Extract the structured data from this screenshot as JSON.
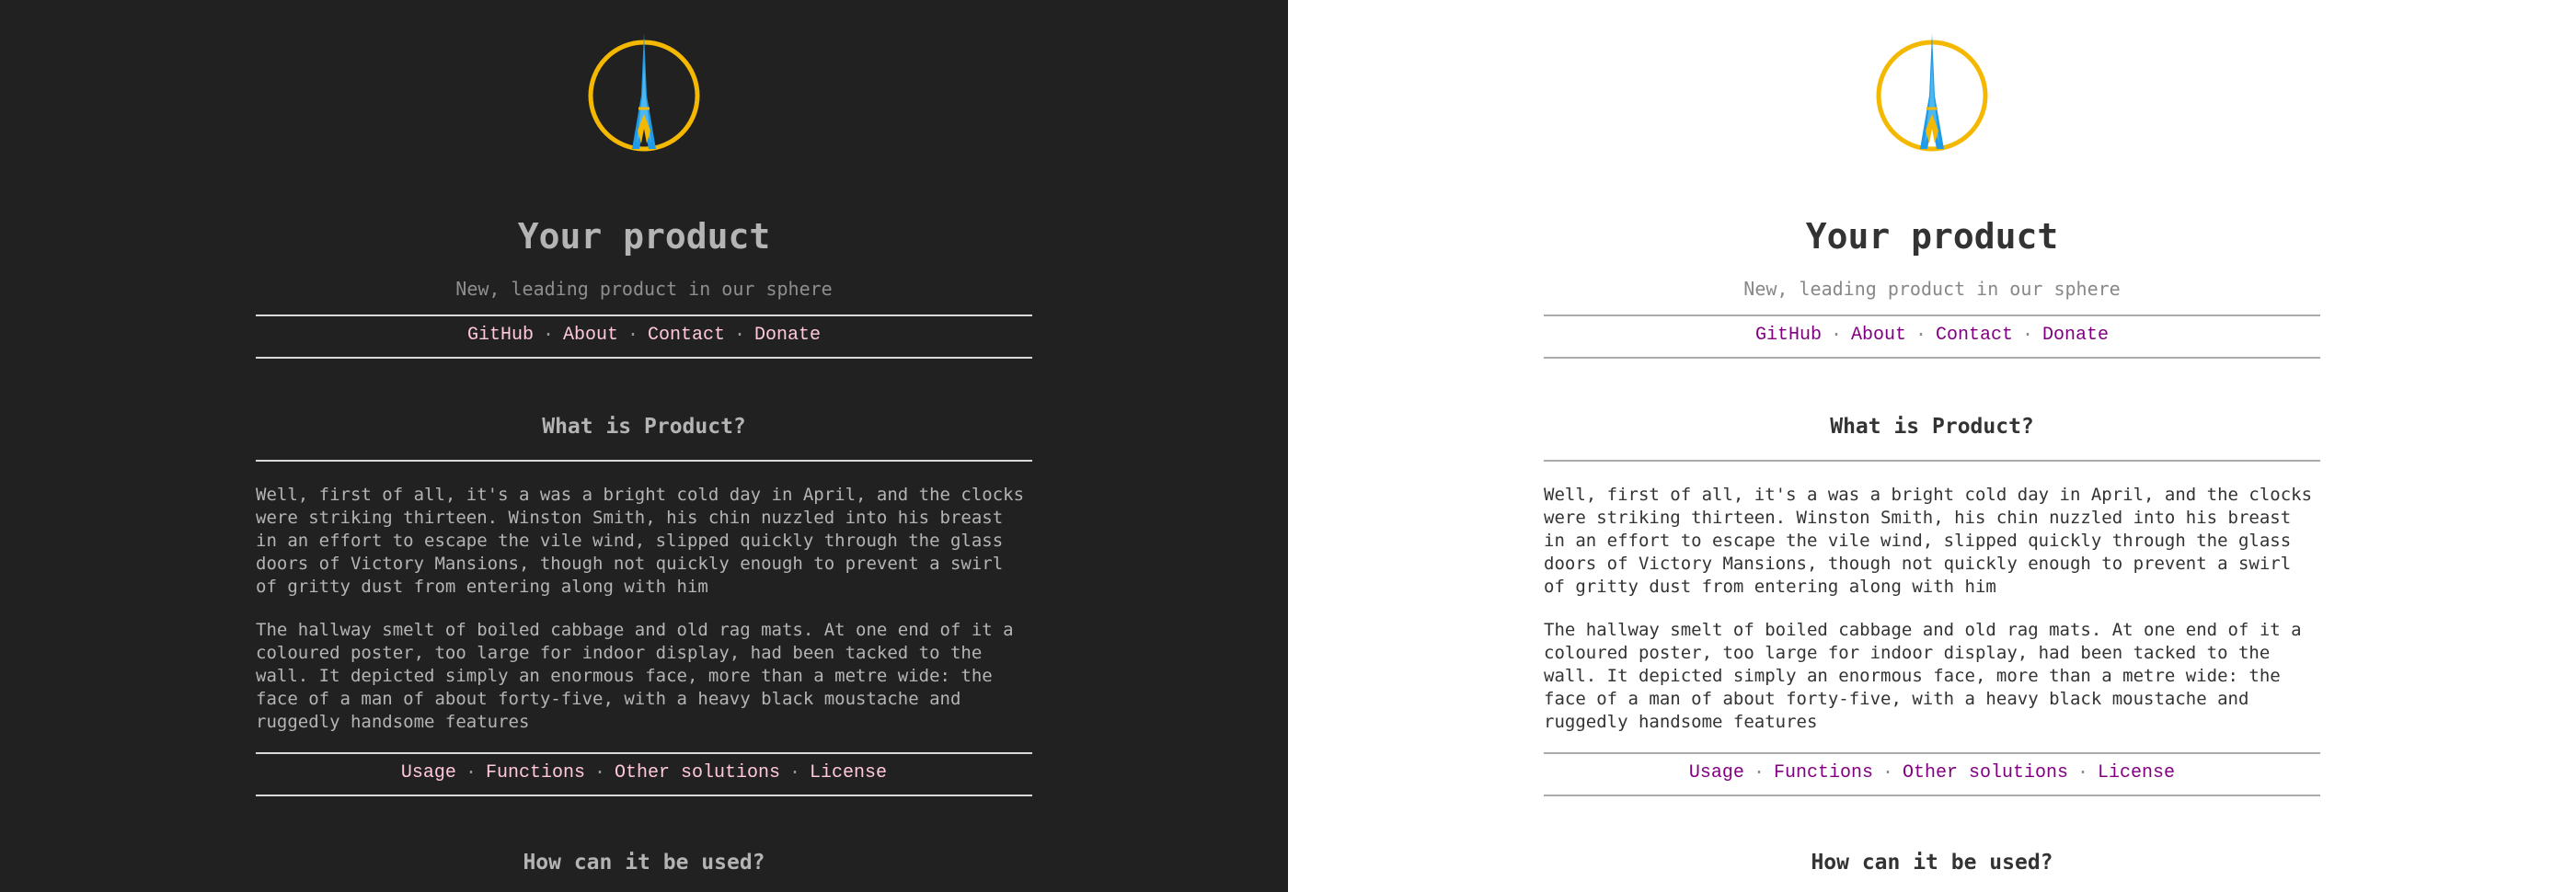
{
  "colors": {
    "dark_background": "#212121",
    "light_background": "#ffffff",
    "dark_link": "#ffc8dc",
    "light_link": "#800080",
    "logo_ring": "#f5b800",
    "logo_spire": "#1e9ae6"
  },
  "logo": {
    "icon": "eiffel-tower-logo-icon"
  },
  "header": {
    "title": "Your product",
    "subtitle": "New, leading product in our sphere"
  },
  "top_nav": {
    "separator": "·",
    "links": [
      "GitHub",
      "About",
      "Contact",
      "Donate"
    ]
  },
  "section_what": {
    "heading": "What is Product?",
    "paragraphs": [
      "Well, first of all, it's a was a bright cold day in April, and the clocks were striking thirteen. Winston Smith, his chin nuzzled into his breast in an effort to escape the vile wind, slipped quickly through the glass doors of Victory Mansions, though not quickly enough to prevent a swirl of gritty dust from entering along with him",
      "The hallway smelt of boiled cabbage and old rag mats. At one end of it a coloured poster, too large for indoor display, had been tacked to the wall. It depicted simply an enormous face, more than a metre wide: the face of a man of about forty-five, with a heavy black moustache and ruggedly handsome features"
    ]
  },
  "section_nav": {
    "separator": "·",
    "links": [
      "Usage",
      "Functions",
      "Other solutions",
      "License"
    ]
  },
  "section_how": {
    "heading": "How can it be used?"
  }
}
